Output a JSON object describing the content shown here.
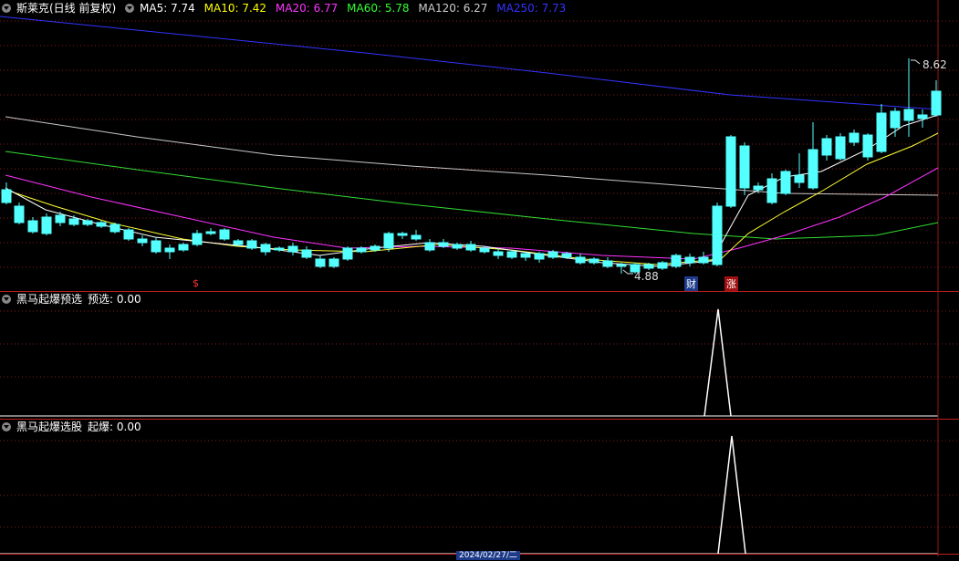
{
  "main": {
    "stock_name": "斯莱克(日线 前复权)",
    "ma": [
      {
        "label": "MA5: 7.74",
        "color": "#ffffff"
      },
      {
        "label": "MA10: 7.42",
        "color": "#ffff00"
      },
      {
        "label": "MA20: 6.77",
        "color": "#ff33ff"
      },
      {
        "label": "MA60: 5.78",
        "color": "#33ff33"
      },
      {
        "label": "MA120: 6.27",
        "color": "#cccccc"
      },
      {
        "label": "MA250: 7.73",
        "color": "#3333ff"
      }
    ],
    "high_label": "8.62",
    "low_label": "4.88",
    "markers": {
      "s": "$",
      "cai": "财",
      "zhang": "涨"
    },
    "colors": {
      "up": "#ff3333",
      "down": "#54ffff",
      "grid": "#8b1a1a",
      "separator": "#c02020"
    }
  },
  "indicator1": {
    "name": "黑马起爆预选",
    "value_label": "预选: 0.00"
  },
  "indicator2": {
    "name": "黑马起爆选股",
    "value_label": "起爆: 0.00"
  },
  "bottom_date": "2024/02/27/二"
}
